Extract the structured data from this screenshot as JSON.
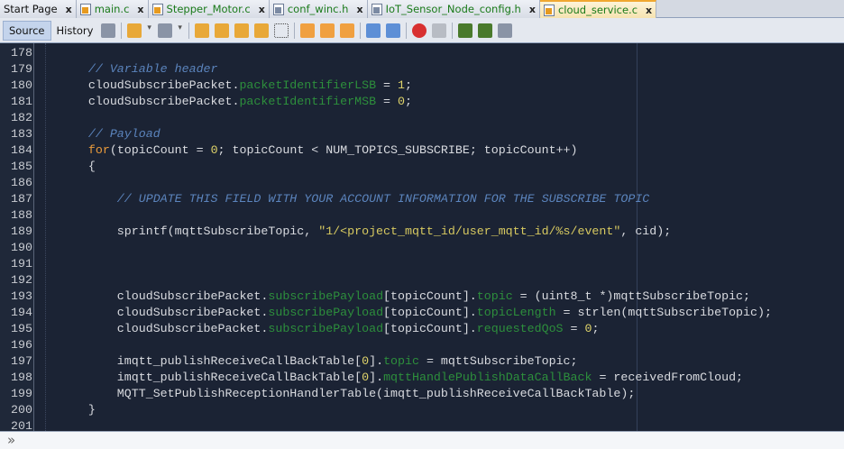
{
  "tabs": [
    {
      "label": "Start Page",
      "type": "page",
      "active": false
    },
    {
      "label": "main.c",
      "type": "c",
      "active": false
    },
    {
      "label": "Stepper_Motor.c",
      "type": "c",
      "active": false
    },
    {
      "label": "conf_winc.h",
      "type": "h",
      "active": false
    },
    {
      "label": "IoT_Sensor_Node_config.h",
      "type": "h",
      "active": false
    },
    {
      "label": "cloud_service.c",
      "type": "c",
      "active": true
    }
  ],
  "toolbar": {
    "source_label": "Source",
    "history_label": "History",
    "icons": [
      "last-edit-icon",
      "|",
      "back-icon",
      "back-dropdown-icon",
      "forward-icon",
      "forward-dropdown-icon",
      "|",
      "find-icon",
      "find-previous-icon",
      "find-next-icon",
      "toggle-highlight-icon",
      "toggle-rect-select-icon",
      "|",
      "previous-bookmark-icon",
      "next-bookmark-icon",
      "toggle-bookmark-icon",
      "|",
      "shift-left-icon",
      "shift-right-icon",
      "|",
      "start-macro-icon",
      "stop-macro-icon",
      "|",
      "comment-icon",
      "uncomment-icon",
      "switch-header-icon"
    ]
  },
  "colors": {
    "background": "#1b2334",
    "comment": "#5b84bd",
    "field": "#2d8f3c",
    "number": "#e0d46a",
    "keyword": "#e89a3c",
    "string": "#d7c960"
  },
  "lines": [
    {
      "n": "178",
      "t": []
    },
    {
      "n": "179",
      "t": [
        [
          "",
          "      "
        ],
        [
          "comment",
          "// Variable header"
        ]
      ]
    },
    {
      "n": "180",
      "t": [
        [
          "",
          "      cloudSubscribePacket."
        ],
        [
          "field",
          "packetIdentifierLSB"
        ],
        [
          "",
          " = "
        ],
        [
          "num",
          "1"
        ],
        [
          "",
          ";"
        ]
      ]
    },
    {
      "n": "181",
      "t": [
        [
          "",
          "      cloudSubscribePacket."
        ],
        [
          "field",
          "packetIdentifierMSB"
        ],
        [
          "",
          " = "
        ],
        [
          "num",
          "0"
        ],
        [
          "",
          ";"
        ]
      ]
    },
    {
      "n": "182",
      "t": []
    },
    {
      "n": "183",
      "t": [
        [
          "",
          "      "
        ],
        [
          "comment",
          "// Payload"
        ]
      ]
    },
    {
      "n": "184",
      "t": [
        [
          "",
          "      "
        ],
        [
          "kw",
          "for"
        ],
        [
          "",
          "(topicCount = "
        ],
        [
          "num",
          "0"
        ],
        [
          "",
          "; topicCount < NUM_TOPICS_SUBSCRIBE; topicCount++)"
        ]
      ]
    },
    {
      "n": "185",
      "t": [
        [
          "",
          "      {"
        ]
      ]
    },
    {
      "n": "186",
      "t": []
    },
    {
      "n": "187",
      "t": [
        [
          "",
          "          "
        ],
        [
          "comment",
          "// UPDATE THIS FIELD WITH YOUR ACCOUNT INFORMATION FOR THE SUBSCRIBE TOPIC"
        ]
      ]
    },
    {
      "n": "188",
      "t": []
    },
    {
      "n": "189",
      "t": [
        [
          "",
          "          sprintf(mqttSubscribeTopic, "
        ],
        [
          "str",
          "\"1/<project_mqtt_id/user_mqtt_id/%s/event\""
        ],
        [
          "",
          ", cid);"
        ]
      ]
    },
    {
      "n": "190",
      "t": []
    },
    {
      "n": "191",
      "t": []
    },
    {
      "n": "192",
      "t": []
    },
    {
      "n": "193",
      "t": [
        [
          "",
          "          cloudSubscribePacket."
        ],
        [
          "field",
          "subscribePayload"
        ],
        [
          "",
          "[topicCount]."
        ],
        [
          "field",
          "topic"
        ],
        [
          "",
          " = (uint8_t *)mqttSubscribeTopic;"
        ]
      ]
    },
    {
      "n": "194",
      "t": [
        [
          "",
          "          cloudSubscribePacket."
        ],
        [
          "field",
          "subscribePayload"
        ],
        [
          "",
          "[topicCount]."
        ],
        [
          "field",
          "topicLength"
        ],
        [
          "",
          " = strlen(mqttSubscribeTopic);"
        ]
      ]
    },
    {
      "n": "195",
      "t": [
        [
          "",
          "          cloudSubscribePacket."
        ],
        [
          "field",
          "subscribePayload"
        ],
        [
          "",
          "[topicCount]."
        ],
        [
          "field",
          "requestedQoS"
        ],
        [
          "",
          " = "
        ],
        [
          "num",
          "0"
        ],
        [
          "",
          ";"
        ]
      ]
    },
    {
      "n": "196",
      "t": []
    },
    {
      "n": "197",
      "t": [
        [
          "",
          "          imqtt_publishReceiveCallBackTable["
        ],
        [
          "num",
          "0"
        ],
        [
          "",
          "]."
        ],
        [
          "field",
          "topic"
        ],
        [
          "",
          " = mqttSubscribeTopic;"
        ]
      ]
    },
    {
      "n": "198",
      "t": [
        [
          "",
          "          imqtt_publishReceiveCallBackTable["
        ],
        [
          "num",
          "0"
        ],
        [
          "",
          "]."
        ],
        [
          "field",
          "mqttHandlePublishDataCallBack"
        ],
        [
          "",
          " = receivedFromCloud;"
        ]
      ]
    },
    {
      "n": "199",
      "t": [
        [
          "",
          "          MQTT_SetPublishReceptionHandlerTable(imqtt_publishReceiveCallBackTable);"
        ]
      ]
    },
    {
      "n": "200",
      "t": [
        [
          "",
          "      }"
        ]
      ]
    },
    {
      "n": "201",
      "t": []
    }
  ],
  "bottom": {
    "icon": "expand-chevron-icon"
  }
}
